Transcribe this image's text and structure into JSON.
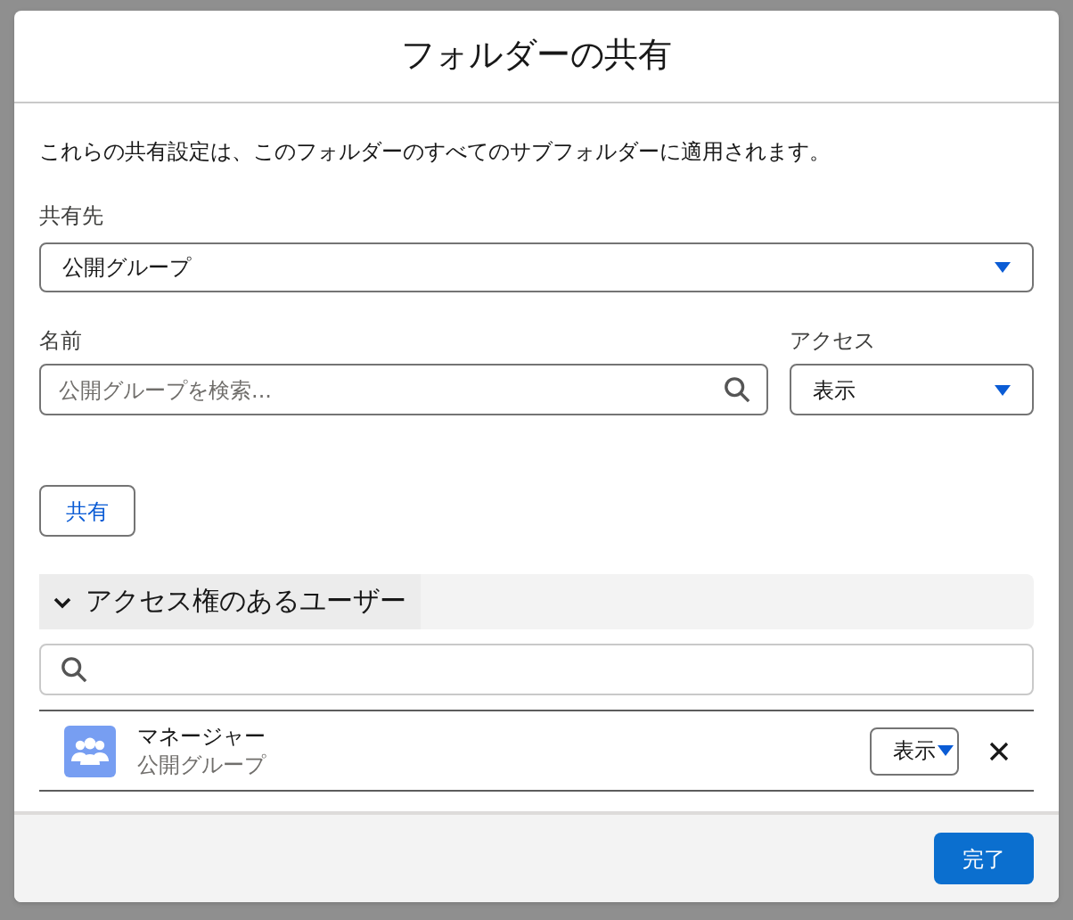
{
  "dialog": {
    "title": "フォルダーの共有",
    "description": "これらの共有設定は、このフォルダーのすべてのサブフォルダーに適用されます。",
    "share_with": {
      "label": "共有先",
      "value": "公開グループ"
    },
    "name_field": {
      "label": "名前",
      "placeholder": "公開グループを検索..."
    },
    "access_field": {
      "label": "アクセス",
      "value": "表示"
    },
    "share_button": "共有",
    "section": {
      "title": "アクセス権のあるユーザー",
      "expanded": true
    },
    "users": [
      {
        "name": "マネージャー",
        "type": "公開グループ",
        "access": "表示"
      }
    ],
    "done_button": "完了"
  }
}
